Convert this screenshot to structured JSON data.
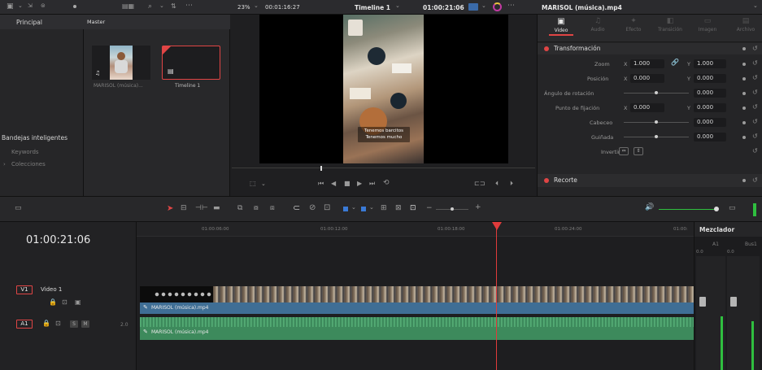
{
  "top": {
    "zoom": "23%",
    "duration": "00:01:16:27",
    "timeline_name": "Timeline 1",
    "timecode": "01:00:21:06",
    "clip_name": "MARISOL (música).mp4"
  },
  "left": {
    "principal_tab": "Principal",
    "smart_bins_title": "Bandejas inteligentes",
    "keywords": "Keywords",
    "collections": "Colecciones"
  },
  "media": {
    "master_label": "Master",
    "clip1_label": "MARISOL (música)...",
    "clip2_label": "Timeline 1"
  },
  "viewer": {
    "subtitle_line1": "Tenemos barcitos",
    "subtitle_line2": "Tenemos mucho"
  },
  "inspector": {
    "tabs": [
      "Video",
      "Audio",
      "Efecto",
      "Transición",
      "Imagen",
      "Archivo"
    ],
    "section_transform": "Transformación",
    "zoom_label": "Zoom",
    "zoom_x": "1.000",
    "zoom_y": "1.000",
    "position_label": "Posición",
    "position_x": "0.000",
    "position_y": "0.000",
    "rotation_label": "Ángulo de rotación",
    "rotation_value": "0.000",
    "anchor_label": "Punto de fijación",
    "anchor_x": "0.000",
    "anchor_y": "0.000",
    "pitch_label": "Cabeceo",
    "pitch_value": "0.000",
    "yaw_label": "Guiñada",
    "yaw_value": "0.000",
    "flip_label": "Invertir",
    "section_crop": "Recorte",
    "x_axis": "X",
    "y_axis": "Y"
  },
  "timeline": {
    "timecode": "01:00:21:06",
    "ruler": [
      "01:00:06:00",
      "01:00:12:00",
      "01:00:18:00",
      "01:00:24:00",
      "01:00:"
    ],
    "v1_label": "V1",
    "v1_name": "Video 1",
    "a1_label": "A1",
    "a1_channels": "2.0",
    "video_clip": "MARISOL (música).mp4",
    "audio_clip": "MARISOL (música).mp4"
  },
  "mixer": {
    "title": "Mezclador",
    "ch1": "A1",
    "ch2": "Bus1",
    "db1": "0.0",
    "db2": "0.0"
  },
  "colors": {
    "video_clip": "#3f6e95",
    "audio_clip": "#3d8a5c",
    "playhead": "#e03b3b",
    "accent_red": "#e04545",
    "meter_green": "#2fbf3f"
  }
}
